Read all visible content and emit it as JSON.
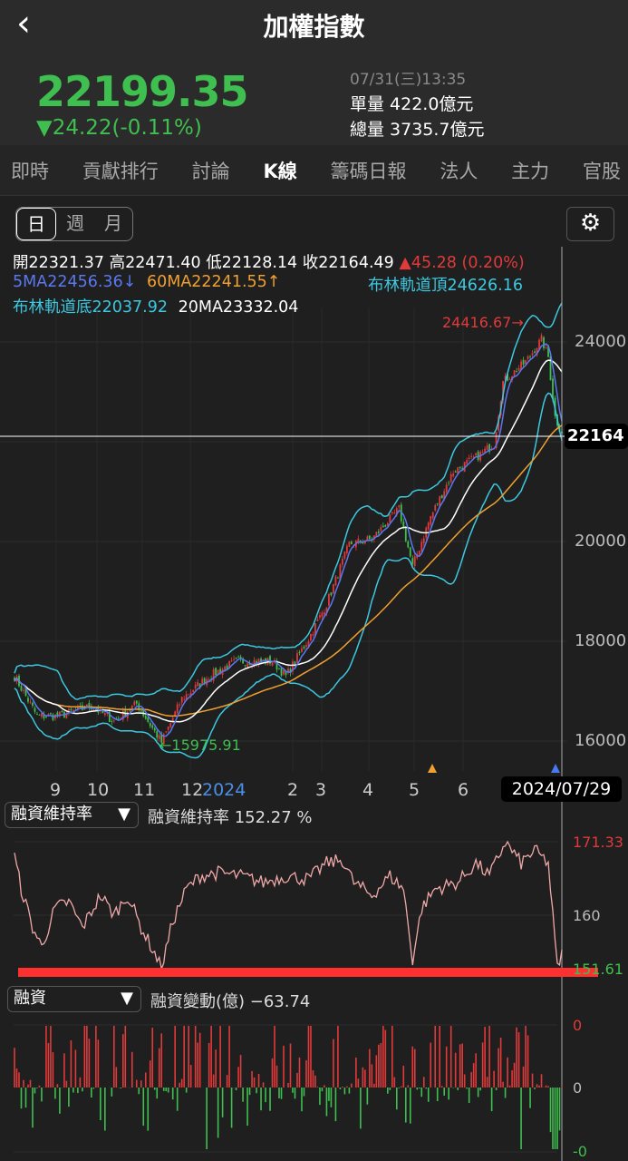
{
  "header": {
    "title": "加權指數",
    "back_icon": "chevron-left-icon"
  },
  "quote": {
    "price": "22199.35",
    "change": "▼24.22(-0.11%)",
    "datetime": "07/31(三)13:35",
    "single_volume": "單量 422.0億元",
    "total_volume": "總量 3735.7億元"
  },
  "tabs": [
    "即時",
    "貢獻排行",
    "討論",
    "K線",
    "籌碼日報",
    "法人",
    "主力",
    "官股"
  ],
  "active_tab": "K線",
  "periods": [
    "日",
    "週",
    "月"
  ],
  "legend": {
    "open": "開22321.37",
    "high": "高22471.40",
    "low": "低22128.14",
    "close": "收22164.49",
    "change": "▲45.28 (0.20%)",
    "ma5": "5MA22456.36↓",
    "ma60": "60MA22241.55↑",
    "boll_top": "布林軌道頂24626.16",
    "boll_bottom": "布林軌道底22037.92",
    "ma20": "20MA23332.04"
  },
  "colors": {
    "up": "#e03a3a",
    "down": "#3fbf4f",
    "ma5": "#5a78f0",
    "ma20": "#ffffff",
    "ma60": "#f0a030",
    "boll": "#3cc8e0",
    "ratio": "#f0a8a8"
  },
  "main_chart": {
    "high_marker": "24416.67→",
    "low_marker": "←15975.91",
    "current_label": "22164",
    "y_ticks": [
      "24000",
      "20000",
      "18000",
      "16000"
    ],
    "x_ticks": [
      "9",
      "10",
      "11",
      "12",
      "2024",
      "2",
      "3",
      "4",
      "5",
      "6"
    ],
    "cursor_date": "2024/07/29"
  },
  "ratio_panel": {
    "selector": "融資維持率",
    "selector_arrow": "▼",
    "info": "融資維持率 152.27 %",
    "y_max": "171.33",
    "y_mid": "160",
    "y_min": "151.61"
  },
  "margin_panel": {
    "selector": "融資",
    "selector_arrow": "▼",
    "info": "融資變動(億) −63.74",
    "y_top": "0",
    "y_zero": "0",
    "y_bottom": "-0"
  },
  "chart_data": {
    "type": "candlestick",
    "bars": 243,
    "close_keypoints": [
      [
        0,
        17300
      ],
      [
        10,
        16500
      ],
      [
        19,
        16500
      ],
      [
        34,
        16700
      ],
      [
        44,
        16400
      ],
      [
        54,
        16750
      ],
      [
        65,
        15976
      ],
      [
        74,
        16850
      ],
      [
        86,
        17300
      ],
      [
        98,
        17600
      ],
      [
        114,
        17600
      ],
      [
        120,
        17300
      ],
      [
        130,
        18050
      ],
      [
        138,
        18750
      ],
      [
        148,
        19950
      ],
      [
        158,
        20050
      ],
      [
        170,
        20650
      ],
      [
        176,
        19500
      ],
      [
        184,
        20500
      ],
      [
        194,
        21400
      ],
      [
        206,
        21750
      ],
      [
        212,
        21950
      ],
      [
        216,
        23200
      ],
      [
        226,
        23600
      ],
      [
        233,
        24050
      ],
      [
        236,
        23700
      ],
      [
        239,
        22500
      ],
      [
        242,
        22164
      ]
    ],
    "ratio_keypoints": [
      [
        0,
        169
      ],
      [
        3,
        164
      ],
      [
        8,
        158
      ],
      [
        12,
        155
      ],
      [
        18,
        161
      ],
      [
        24,
        162
      ],
      [
        30,
        158
      ],
      [
        38,
        163
      ],
      [
        44,
        160
      ],
      [
        50,
        163
      ],
      [
        56,
        158
      ],
      [
        62,
        154
      ],
      [
        65,
        151.6
      ],
      [
        70,
        159
      ],
      [
        76,
        164
      ],
      [
        82,
        166
      ],
      [
        90,
        166.5
      ],
      [
        100,
        166
      ],
      [
        110,
        165
      ],
      [
        120,
        166
      ],
      [
        130,
        165.5
      ],
      [
        138,
        168
      ],
      [
        145,
        168.5
      ],
      [
        150,
        165
      ],
      [
        158,
        163
      ],
      [
        166,
        166
      ],
      [
        172,
        164
      ],
      [
        176,
        153
      ],
      [
        180,
        161
      ],
      [
        186,
        164
      ],
      [
        196,
        165
      ],
      [
        204,
        168
      ],
      [
        210,
        166
      ],
      [
        217,
        171.3
      ],
      [
        224,
        168
      ],
      [
        230,
        170
      ],
      [
        236,
        168
      ],
      [
        240,
        151.6
      ],
      [
        242,
        154
      ]
    ],
    "ratio_ylim": [
      151.61,
      171.33
    ],
    "price_ylim": [
      15700,
      25000
    ]
  }
}
